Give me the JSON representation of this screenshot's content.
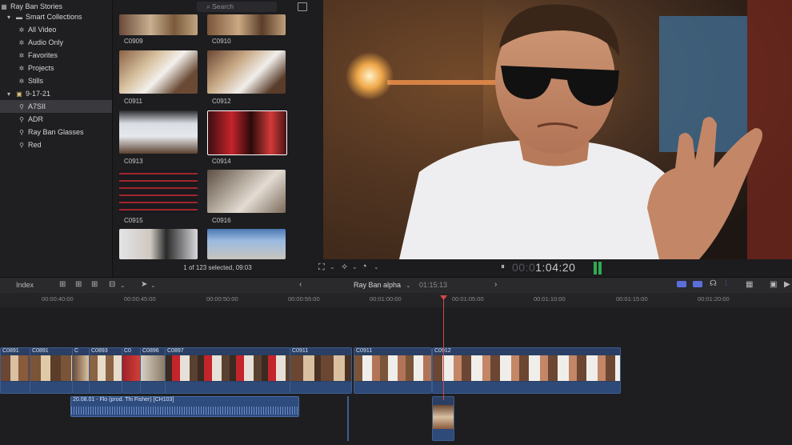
{
  "sidebar": {
    "library": "Ray Ban Stories",
    "items": [
      {
        "label": "Smart Collections",
        "icon": "folder-icon"
      },
      {
        "label": "All Video",
        "icon": "gear-icon"
      },
      {
        "label": "Audio Only",
        "icon": "gear-icon"
      },
      {
        "label": "Favorites",
        "icon": "gear-icon"
      },
      {
        "label": "Projects",
        "icon": "gear-icon"
      },
      {
        "label": "Stills",
        "icon": "gear-icon"
      },
      {
        "label": "9-17-21",
        "icon": "event-icon"
      },
      {
        "label": "A7SII",
        "icon": "keyword-icon"
      },
      {
        "label": "ADR",
        "icon": "keyword-icon"
      },
      {
        "label": "Ray Ban Glasses",
        "icon": "keyword-icon"
      },
      {
        "label": "Red",
        "icon": "keyword-icon"
      }
    ]
  },
  "browser": {
    "search_placeholder": "Search",
    "thumbs": [
      "C0909",
      "C0910",
      "C0911",
      "C0912",
      "C0913",
      "C0914",
      "C0915",
      "C0916"
    ],
    "status": "1 of 123 selected, 09:03"
  },
  "viewer": {
    "timecode_dim": "00:0",
    "timecode": "1:04:20"
  },
  "timeline": {
    "index_label": "Index",
    "project_name": "Ray Ban alpha",
    "duration": "01:15:13",
    "ruler": [
      "00:00:40:00",
      "00:00:45:00",
      "00:00:50:00",
      "00:00:55:00",
      "00:01:00:00",
      "00:01:05:00",
      "00:01:10:00",
      "00:01:15:00",
      "00:01:20:00"
    ],
    "clips": [
      "C0891",
      "C0891",
      "C",
      "C0893",
      "C0",
      "C0896",
      "C0897",
      "C0911",
      "C0911",
      "C0912"
    ],
    "audio_clip": "20.08.01 - Flo (prod. Thi Fisher) [CH103]"
  },
  "colors": {
    "clip_blue": "#2a3f63",
    "playhead": "#d04848",
    "selection": "#ffffff"
  }
}
